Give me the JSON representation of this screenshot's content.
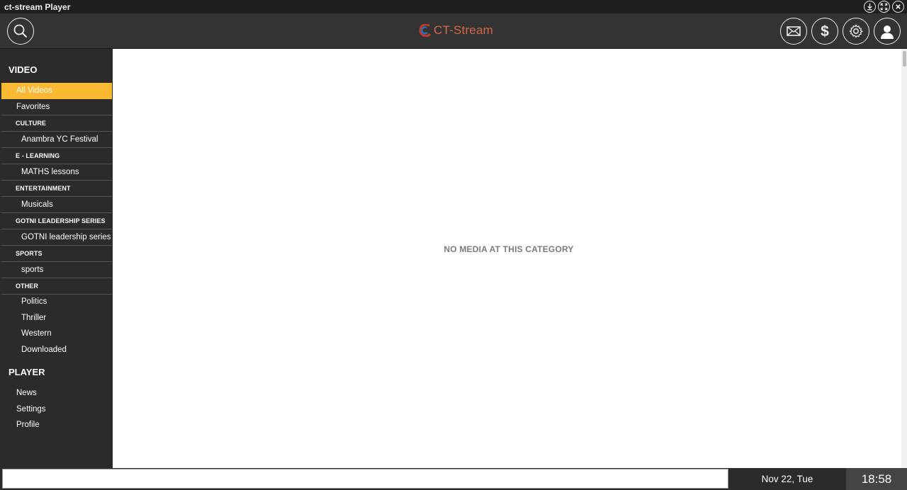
{
  "window": {
    "title": "ct-stream Player"
  },
  "header": {
    "logo_text": "CT-Stream"
  },
  "sidebar": {
    "video_title": "VIDEO",
    "all_videos": "All Videos",
    "favorites": "Favorites",
    "categories": [
      {
        "name": "CULTURE",
        "items": [
          "Anambra YC Festival"
        ]
      },
      {
        "name": "E - LEARNING",
        "items": [
          "MATHS lessons"
        ]
      },
      {
        "name": "ENTERTAINMENT",
        "items": [
          "Musicals"
        ]
      },
      {
        "name": "GOTNI LEADERSHIP SERIES",
        "items": [
          "GOTNI leadership series"
        ]
      },
      {
        "name": "SPORTS",
        "items": [
          "sports"
        ]
      },
      {
        "name": "OTHER",
        "items": [
          "Politics",
          "Thriller",
          "Western",
          "Downloaded"
        ]
      }
    ],
    "player_title": "PLAYER",
    "player_items": [
      "News",
      "Settings",
      "Profile"
    ]
  },
  "main": {
    "empty_message": "NO MEDIA AT THIS CATEGORY"
  },
  "footer": {
    "input_value": "",
    "date": "Nov 22, Tue",
    "time": "18:58"
  },
  "colors": {
    "accent": "#fbb833",
    "logo": "#d26a4a",
    "sidebar_bg": "#2b2b2b",
    "header_bg": "#333333"
  }
}
